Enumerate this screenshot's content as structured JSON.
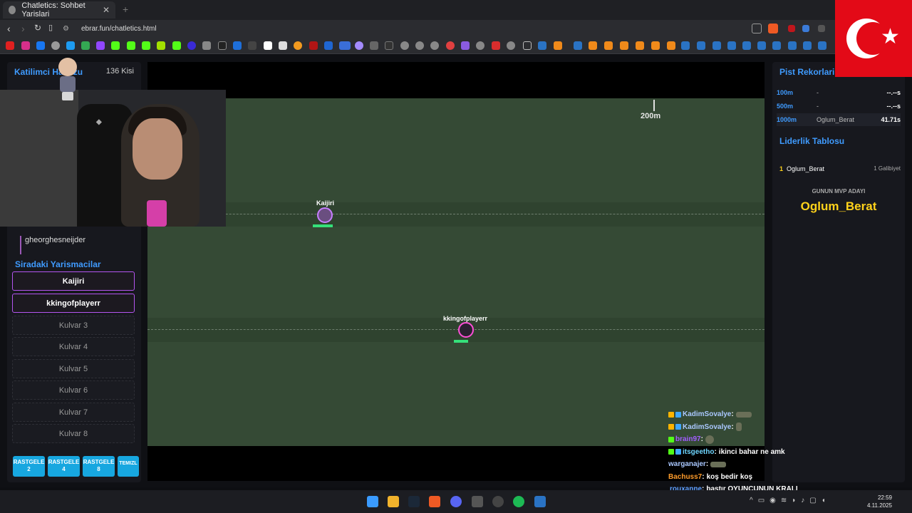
{
  "browser": {
    "tab_title": "Chatletics: Sohbet Yarislari",
    "tab_close": "✕",
    "new_tab": "+",
    "url": "ebrar.fun/chatletics.html"
  },
  "left_panel": {
    "title": "Katilimci Havuzu",
    "count": "136 Kisi",
    "visible_user": "gheorghesneijder",
    "queue_title": "Siradaki Yarismacilar",
    "slots": [
      "Kaijiri",
      "kkingofplayerr",
      "Kulvar 3",
      "Kulvar 4",
      "Kulvar 5",
      "Kulvar 6",
      "Kulvar 7",
      "Kulvar 8"
    ],
    "buttons": [
      "RASTGELE 2",
      "RASTGELE 4",
      "RASTGELE 8",
      "TEMIZL"
    ]
  },
  "track": {
    "marker_label": "200m",
    "runners": [
      {
        "name": "Kaijiri",
        "lane": 1
      },
      {
        "name": "kkingofplayerr",
        "lane": 2
      }
    ]
  },
  "chat": [
    {
      "user": "KadimSovalye",
      "color": "#aac8ff",
      "msg": ""
    },
    {
      "user": "KadimSovalye",
      "color": "#aac8ff",
      "msg": ""
    },
    {
      "user": "brain97",
      "color": "#a25dff",
      "msg": ""
    },
    {
      "user": "itsgeetho",
      "color": "#6fd6ff",
      "msg": "ikinci bahar ne amk"
    },
    {
      "user": "warganajer",
      "color": "#aac8ff",
      "msg": ""
    },
    {
      "user": "Bachuss7",
      "color": "#ff9c2b",
      "msg": "koş bedir koş"
    },
    {
      "user": "rouxanne",
      "color": "#5fa0ff",
      "msg": "bastır OYUNCUNUN KRALI"
    }
  ],
  "right_panel": {
    "records_title": "Pist Rekorlari",
    "records": [
      {
        "dist": "100m",
        "name": "-",
        "time": "--.--s"
      },
      {
        "dist": "500m",
        "name": "-",
        "time": "--.--s"
      },
      {
        "dist": "1000m",
        "name": "Oglum_Berat",
        "time": "41.71s"
      }
    ],
    "leaderboard_title": "Liderlik Tablosu",
    "leaderboard": [
      {
        "rank": "1",
        "name": "Oglum_Berat",
        "wins": "1 Galibiyet"
      }
    ],
    "mvp_label": "GUNUN MVP ADAYI",
    "mvp_name": "Oglum_Berat"
  },
  "taskbar": {
    "time": "22:59",
    "date": "4.11.2025"
  },
  "colors": {
    "accent": "#3f9bff",
    "purple": "#b455f0",
    "field": "#354a35",
    "mvp": "#ffd21a"
  }
}
